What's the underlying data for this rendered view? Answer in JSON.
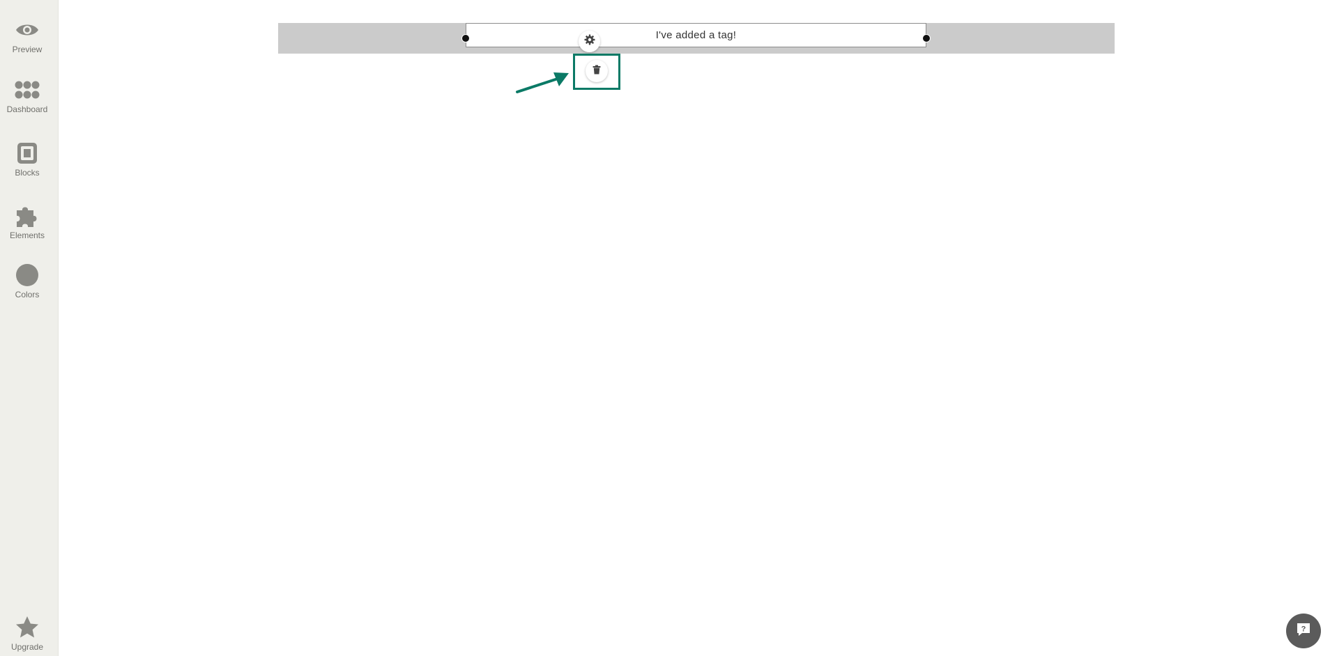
{
  "sidebar": {
    "items": [
      {
        "id": "preview",
        "label": "Preview",
        "icon": "eye-icon"
      },
      {
        "id": "dashboard",
        "label": "Dashboard",
        "icon": "dots-grid-icon"
      },
      {
        "id": "blocks",
        "label": "Blocks",
        "icon": "block-square-icon"
      },
      {
        "id": "elements",
        "label": "Elements",
        "icon": "puzzle-icon"
      },
      {
        "id": "colors",
        "label": "Colors",
        "icon": "color-circle-icon"
      }
    ],
    "upgrade": {
      "label": "Upgrade",
      "icon": "star-icon"
    }
  },
  "canvas": {
    "tag_text": "I've added a tag!",
    "settings_icon": "gear-icon",
    "delete_icon": "trash-icon",
    "annotation": {
      "color": "#0b7a66",
      "arrow_icon": "arrow-icon"
    }
  },
  "help": {
    "icon": "help-chat-icon"
  },
  "colors": {
    "sidebar_bg": "#efefea",
    "icon_gray": "#8a8a85",
    "band_gray": "#cbcbcb",
    "accent_green": "#0b7a66"
  }
}
